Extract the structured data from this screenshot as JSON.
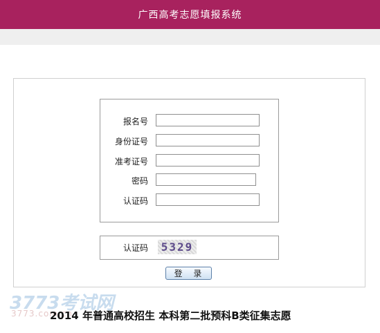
{
  "header": {
    "title": "广西高考志愿填报系统"
  },
  "form": {
    "fields": [
      {
        "label": "报名号",
        "value": ""
      },
      {
        "label": "身份证号",
        "value": ""
      },
      {
        "label": "准考证号",
        "value": ""
      },
      {
        "label": "密码",
        "value": ""
      },
      {
        "label": "认证码",
        "value": ""
      }
    ]
  },
  "captcha": {
    "label": "认证码",
    "code": "5329"
  },
  "login": {
    "label": "登 录"
  },
  "watermark": {
    "text": "3773考试网",
    "url": "3773.com.cn"
  },
  "banner": {
    "text": "2014 年普通高校招生 本科第二批预科B类征集志愿"
  },
  "colors": {
    "accent": "#a8225e",
    "subbar": "#efefef"
  }
}
